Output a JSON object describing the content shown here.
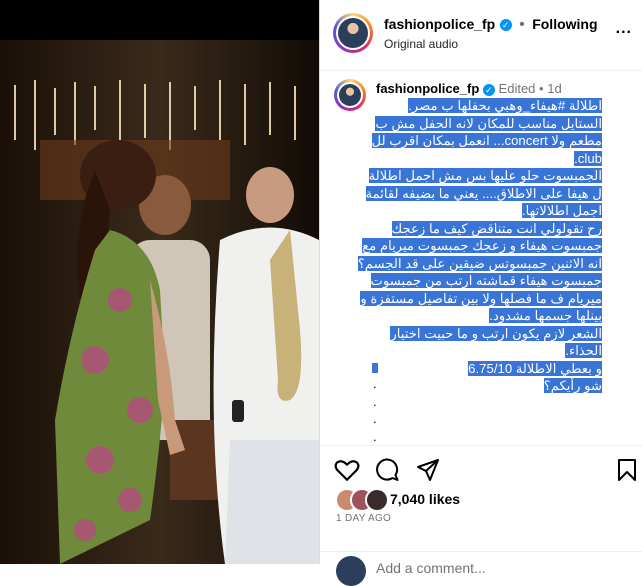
{
  "header": {
    "username": "fashionpolice_fp",
    "separator": "•",
    "follow_label": "Following",
    "audio_label": "Original audio",
    "more_label": "..."
  },
  "caption": {
    "username": "fashionpolice_fp",
    "edited_label": "Edited",
    "separator": "•",
    "time_ago": "1d",
    "lines": [
      "اطلالة #هيفاء_وهبي بحفلها ب مصر.",
      "الستايل مناسب للمكان لانه الحفل مش ب مطعم ولا concert... انعمل بمكان اقرب لل club.",
      "الجمبسوت حلو عليها بس مش اجمل اطلالة ل هيفا على الاطلاق.... يعني ما بضيفه لقائمة اجمل اطلالاتها.",
      "رح تقولولي انت متناقض كيف ما زعجك جمبسوت هيفاء و زعجك جمبسوت ميريام مع انه الاثنين جمبسوتس ضيقين على قد الجسم؟",
      "جمبسوت هيفاء قماشته ارتب من جمبسوت ميريام ف ما فصلها ولا بين تفاصيل مستفزة و بينلها جسمها مشدود.",
      "الشعر لازم يكون ارتب و ما حبيت اختيار الحذاء.",
      "و بعطي الاطلالة 6.75/10",
      "شو رأيكم؟"
    ],
    "dots": [
      ".",
      ".",
      ".",
      ".",
      "."
    ]
  },
  "actions": {
    "likes_text": "7,040 likes",
    "time_text": "1 DAY AGO",
    "comment_placeholder": "Add a comment..."
  },
  "icons": {
    "like": "heart-icon",
    "comment": "comment-icon",
    "share": "send-icon",
    "save": "bookmark-icon",
    "more": "more-icon",
    "verified": "verified-badge-icon"
  },
  "colors": {
    "highlight": "#3875d7",
    "verified": "#0095f6",
    "muted": "#737373"
  }
}
